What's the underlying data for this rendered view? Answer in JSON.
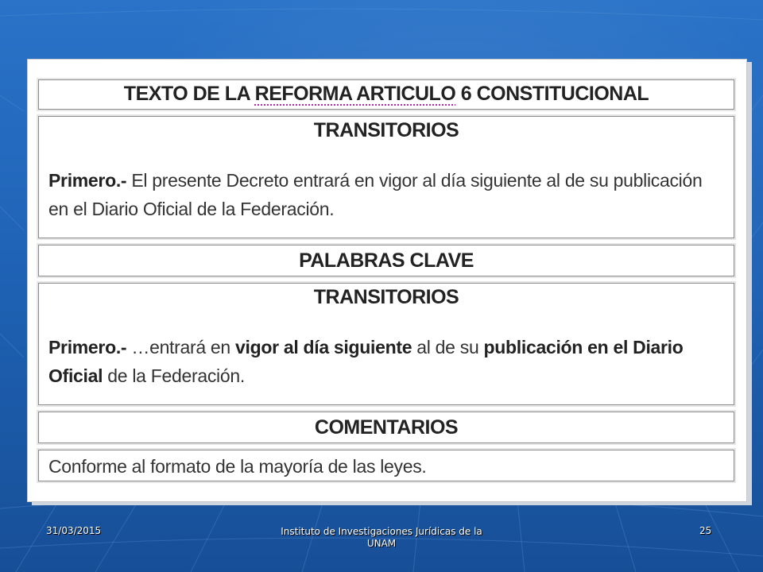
{
  "table": {
    "title_prefix": "TEXTO DE LA ",
    "title_underlined": "REFORMA ARTICULO",
    "title_suffix": " 6 CONSTITUCIONAL",
    "section1": {
      "heading": "TRANSITORIOS",
      "lead": "Primero.-",
      "text": " El presente Decreto entrará en vigor al día siguiente al de su publicación en el Diario Oficial de la Federación."
    },
    "section2": {
      "heading": "PALABRAS CLAVE"
    },
    "section3": {
      "heading": "TRANSITORIOS",
      "lead": "Primero.-",
      "part1": " …entrará en ",
      "bold1": "vigor al día siguiente",
      "part2": " al de su ",
      "bold2": "publicación en el Diario Oficial",
      "part3": " de la Federación."
    },
    "section4": {
      "heading": "COMENTARIOS",
      "text": "Conforme al formato de la mayoría de las leyes."
    }
  },
  "footer": {
    "date": "31/03/2015",
    "institution": "Instituto de Investigaciones Jurídicas de la UNAM",
    "page": "25"
  },
  "colors": {
    "background": "#1f63b6",
    "panel": "#ffffff",
    "underline": "#b42ba8"
  }
}
